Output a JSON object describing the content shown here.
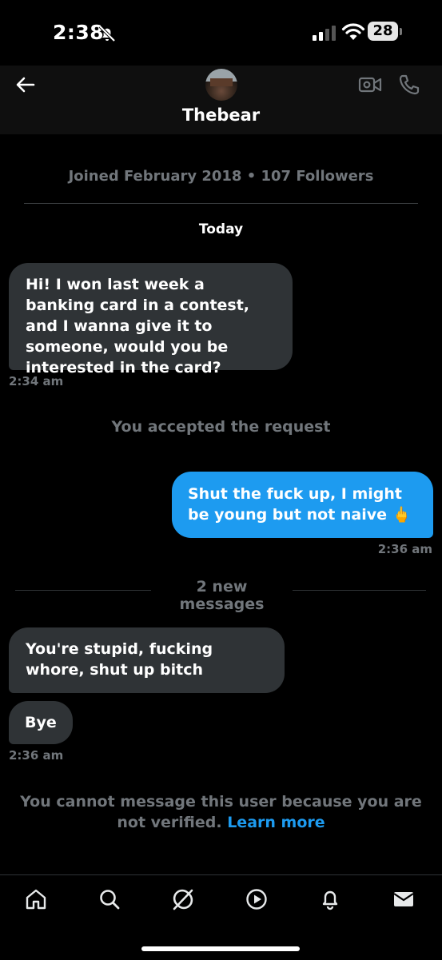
{
  "status_bar": {
    "time": "2:38",
    "battery": "28"
  },
  "header": {
    "title": "Thebear"
  },
  "conversation": {
    "profile_info": "Joined February 2018 • 107 Followers",
    "day_separator": "Today",
    "messages": [
      {
        "direction": "incoming",
        "text": "Hi! I won last week a banking card in a  contest, and I wanna give it to someone, would you be interested in the card?"
      },
      {
        "direction": "outgoing",
        "text": "Shut the fuck up, I might be young but not naive 🖕"
      },
      {
        "direction": "incoming",
        "text": "You're stupid, fucking whore, shut up bitch"
      },
      {
        "direction": "incoming",
        "text": "Bye"
      }
    ],
    "timestamps": [
      "2:34 am",
      "2:36 am",
      "2:36 am"
    ],
    "accepted_notice": "You accepted the request",
    "new_messages_label": "2 new messages",
    "restriction_text": "You cannot message this user because you are not verified.",
    "learn_more": "Learn more"
  },
  "tab_bar": {
    "items": [
      "home-icon",
      "search-icon",
      "grok-icon",
      "video-icon",
      "notifications-icon",
      "messages-icon"
    ]
  },
  "colors": {
    "accent": "#1d9bf0",
    "incoming_bubble": "#2f3336",
    "muted_text": "#71767b"
  }
}
